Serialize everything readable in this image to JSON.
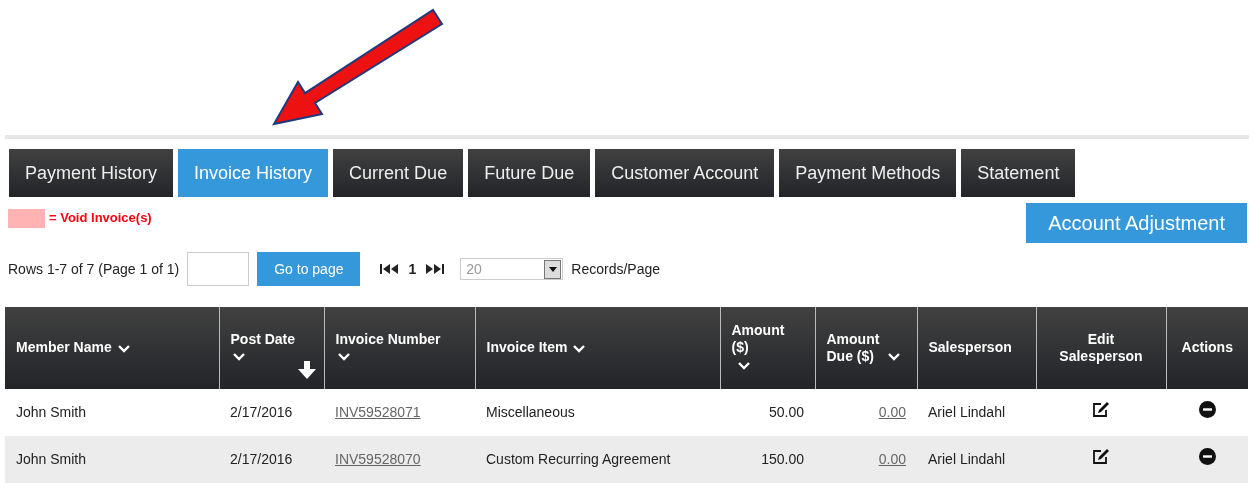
{
  "tabs": [
    {
      "label": "Payment History",
      "selected": false
    },
    {
      "label": "Invoice History",
      "selected": true
    },
    {
      "label": "Current Due",
      "selected": false
    },
    {
      "label": "Future Due",
      "selected": false
    },
    {
      "label": "Customer Account",
      "selected": false
    },
    {
      "label": "Payment Methods",
      "selected": false
    },
    {
      "label": "Statement",
      "selected": false
    }
  ],
  "legend": {
    "color": "#ffb3b3",
    "label": "= Void Invoice(s)"
  },
  "account_adjustment_button": "Account Adjustment",
  "pager": {
    "rows_info": "Rows 1-7 of 7 (Page 1 of 1)",
    "go_button": "Go to page",
    "current_page": "1",
    "page_size": "20",
    "page_size_label": "Records/Page"
  },
  "table": {
    "columns": [
      {
        "label": "Member Name",
        "sortable": true,
        "sorted": false
      },
      {
        "label": "Post Date",
        "sortable": true,
        "sorted": true
      },
      {
        "label": "Invoice Number",
        "sortable": true,
        "sorted": false
      },
      {
        "label": "Invoice Item",
        "sortable": true,
        "sorted": false
      },
      {
        "label": "Amount ($)",
        "sortable": true,
        "sorted": false
      },
      {
        "label": "Amount Due ($)",
        "sortable": true,
        "sorted": false
      },
      {
        "label": "Salesperson",
        "sortable": false,
        "sorted": false
      },
      {
        "label": "Edit Salesperson",
        "sortable": false,
        "sorted": false
      },
      {
        "label": "Actions",
        "sortable": false,
        "sorted": false
      }
    ],
    "rows": [
      {
        "member_name": "John Smith",
        "post_date": "2/17/2016",
        "invoice_number": "INV59528071",
        "invoice_item": "Miscellaneous",
        "amount": "50.00",
        "amount_due": "0.00",
        "salesperson": "Ariel Lindahl"
      },
      {
        "member_name": "John Smith",
        "post_date": "2/17/2016",
        "invoice_number": "INV59528070",
        "invoice_item": "Custom Recurring Agreement",
        "amount": "150.00",
        "amount_due": "0.00",
        "salesperson": "Ariel Lindahl"
      }
    ]
  }
}
